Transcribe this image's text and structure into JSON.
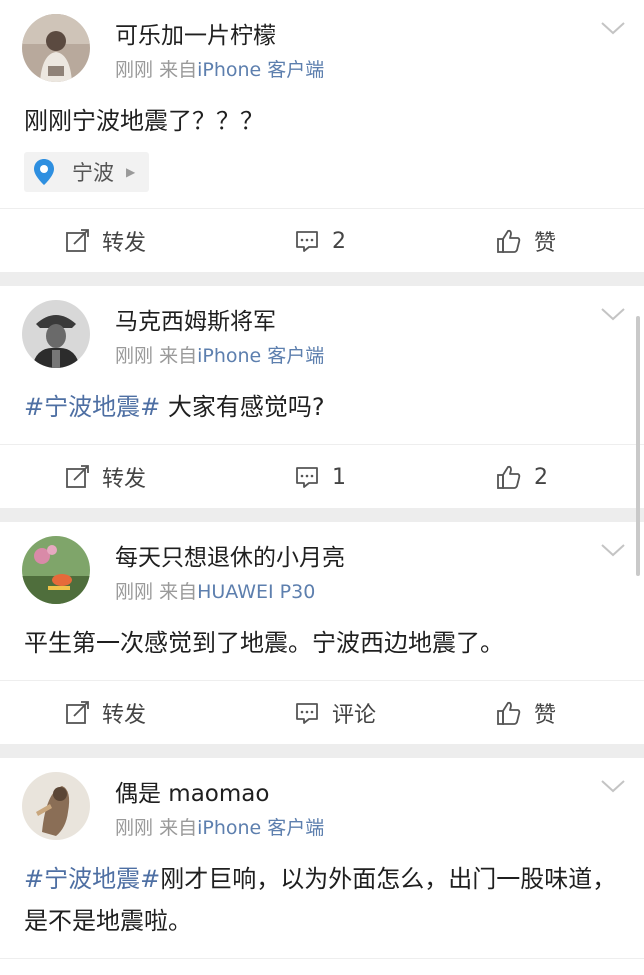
{
  "posts": [
    {
      "username": "可乐加一片柠檬",
      "time": "刚刚",
      "source_prefix": "来自",
      "source": "iPhone 客户端",
      "topic": "",
      "text": "刚刚宁波地震了？？？",
      "location": "宁波",
      "forward": "转发",
      "comment": "2",
      "like": "赞"
    },
    {
      "username": "马克西姆斯将军",
      "time": "刚刚",
      "source_prefix": "来自",
      "source": "iPhone 客户端",
      "topic": "#宁波地震#",
      "text": " 大家有感觉吗?",
      "location": "",
      "forward": "转发",
      "comment": "1",
      "like": "2"
    },
    {
      "username": "每天只想退休的小月亮",
      "time": "刚刚",
      "source_prefix": "来自",
      "source": "HUAWEI P30",
      "topic": "",
      "text": "平生第一次感觉到了地震。宁波西边地震了。",
      "location": "",
      "forward": "转发",
      "comment": "评论",
      "like": "赞"
    },
    {
      "username": "偶是 maomao",
      "time": "刚刚",
      "source_prefix": "来自",
      "source": "iPhone 客户端",
      "topic": "#宁波地震#",
      "text": "刚才巨响，以为外面怎么，出门一股味道，是不是地震啦。",
      "location": "",
      "forward": "转发",
      "comment": "评论",
      "like": "赞"
    }
  ],
  "icons": {
    "forward": "edit-share-icon",
    "comment": "comment-bubble-icon",
    "like": "thumbs-up-icon",
    "location": "location-pin-icon",
    "menu": "chevron-down-icon"
  },
  "colors": {
    "topic": "#4e6fa3",
    "source": "#5d7fae",
    "pin": "#2e8fe0"
  }
}
